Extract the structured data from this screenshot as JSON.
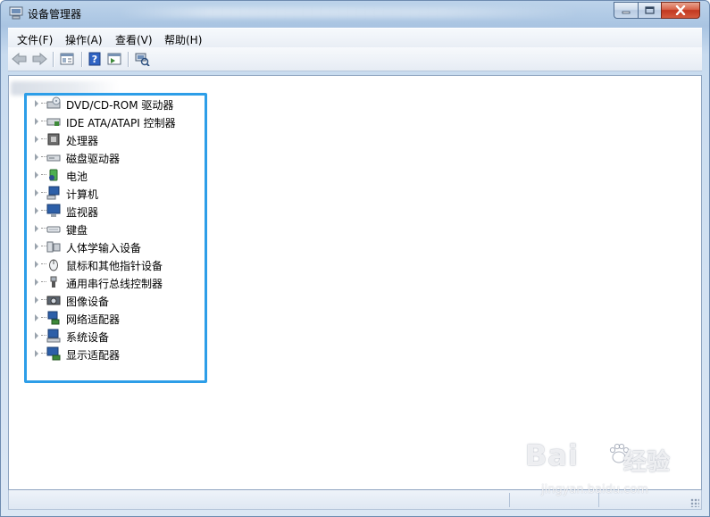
{
  "window": {
    "title": "设备管理器"
  },
  "menubar": {
    "items": [
      "文件(F)",
      "操作(A)",
      "查看(V)",
      "帮助(H)"
    ]
  },
  "toolbar": {
    "buttons": [
      "back-icon",
      "forward-icon",
      "properties-pane-icon",
      "help-icon",
      "action-pane-icon",
      "scan-hardware-icon"
    ]
  },
  "tree": {
    "items": [
      {
        "label": "DVD/CD-ROM 驱动器",
        "icon": "dvd-drive-icon"
      },
      {
        "label": "IDE ATA/ATAPI 控制器",
        "icon": "ide-controller-icon"
      },
      {
        "label": "处理器",
        "icon": "processor-icon"
      },
      {
        "label": "磁盘驱动器",
        "icon": "disk-drive-icon"
      },
      {
        "label": "电池",
        "icon": "battery-icon"
      },
      {
        "label": "计算机",
        "icon": "computer-icon"
      },
      {
        "label": "监视器",
        "icon": "monitor-icon"
      },
      {
        "label": "键盘",
        "icon": "keyboard-icon"
      },
      {
        "label": "人体学输入设备",
        "icon": "hid-icon"
      },
      {
        "label": "鼠标和其他指针设备",
        "icon": "mouse-icon"
      },
      {
        "label": "通用串行总线控制器",
        "icon": "usb-icon"
      },
      {
        "label": "图像设备",
        "icon": "imaging-device-icon"
      },
      {
        "label": "网络适配器",
        "icon": "network-adapter-icon"
      },
      {
        "label": "系统设备",
        "icon": "system-device-icon"
      },
      {
        "label": "显示适配器",
        "icon": "display-adapter-icon"
      }
    ]
  },
  "colors": {
    "highlight": "#2d9ee8",
    "close_button": "#c2371f"
  },
  "watermark": {
    "brand": "Bai",
    "suffix": "经验",
    "url": "jingyan.baidu.com"
  }
}
